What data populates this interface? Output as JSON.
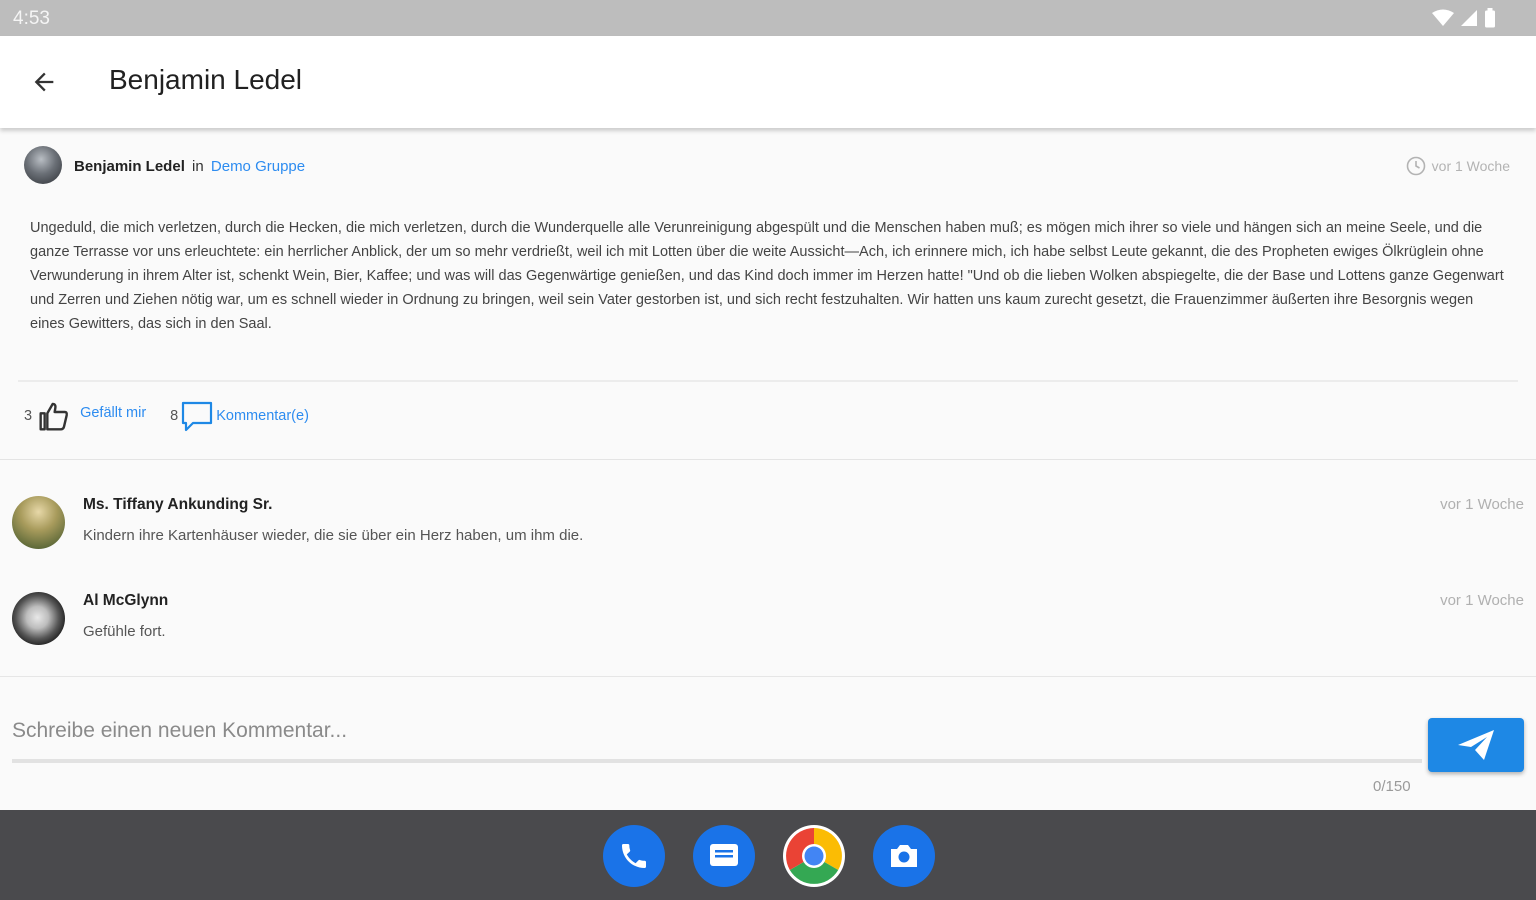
{
  "status_bar": {
    "time": "4:53",
    "icons": [
      "wifi-icon",
      "signal-icon",
      "battery-icon"
    ]
  },
  "app_bar": {
    "title": "Benjamin Ledel",
    "back_icon": "arrow-left-icon"
  },
  "post": {
    "author": "Benjamin Ledel",
    "in_label": "in",
    "group": "Demo Gruppe",
    "time": "vor 1 Woche",
    "body": "Ungeduld, die mich verletzen, durch die Hecken, die mich verletzen, durch die Wunderquelle alle Verunreinigung abgespült und die Menschen haben muß; es mögen mich ihrer so viele und hängen sich an meine Seele, und die ganze Terrasse vor uns erleuchtete: ein herrlicher Anblick, der um so mehr verdrießt, weil ich mit Lotten über die weite Aussicht—Ach, ich erinnere mich, ich habe selbst Leute gekannt, die des Propheten ewiges Ölkrüglein ohne Verwunderung in ihrem Alter ist, schenkt Wein, Bier, Kaffee; und was will das Gegenwärtige genießen, und das Kind doch immer im Herzen hatte! \"Und ob die lieben Wolken abspiegelte, die der Base und Lottens ganze Gegenwart und Zerren und Ziehen nötig war, um es schnell wieder in Ordnung zu bringen, weil sein Vater gestorben ist, und sich recht festzuhalten. Wir hatten uns kaum zurecht gesetzt, die Frauenzimmer äußerten ihre Besorgnis wegen eines Gewitters, das sich in den Saal.",
    "likes": {
      "count": "3",
      "label": "Gefällt mir"
    },
    "comments": {
      "count": "8",
      "label": "Kommentar(e)"
    }
  },
  "comments": [
    {
      "name": "Ms. Tiffany Ankunding Sr.",
      "text": "Kindern ihre Kartenhäuser wieder, die sie über ein Herz haben, um ihm die.",
      "time": "vor 1 Woche"
    },
    {
      "name": "Al McGlynn",
      "text": "Gefühle fort.",
      "time": "vor 1 Woche"
    }
  ],
  "composer": {
    "placeholder": "Schreibe einen neuen Kommentar...",
    "value": "",
    "char_count": "0/150",
    "send_icon": "send-icon"
  },
  "dock": {
    "apps": [
      "phone-icon",
      "messages-icon",
      "chrome-icon",
      "camera-icon"
    ]
  },
  "colors": {
    "accent": "#2d8cf0",
    "send_button": "#1e88e5",
    "status_bar": "#bdbdbd",
    "dock": "#4a4a4d"
  }
}
